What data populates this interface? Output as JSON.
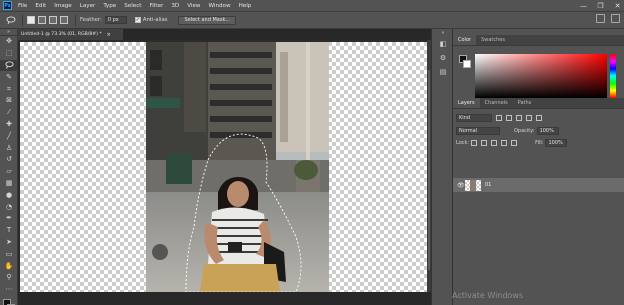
{
  "menubar": {
    "logo": "Ps",
    "items": [
      "File",
      "Edit",
      "Image",
      "Layer",
      "Type",
      "Select",
      "Filter",
      "3D",
      "View",
      "Window",
      "Help"
    ]
  },
  "window_controls": [
    "—",
    "❐",
    "✕"
  ],
  "options": {
    "feather_label": "Feather:",
    "feather_value": "0 px",
    "antialias_label": "Anti-alias",
    "antialias_checked": true,
    "select_mask_label": "Select and Mask..."
  },
  "document": {
    "tab_title": "Untitled-1 @ 73.3% (01, RGB/8#) *",
    "tab_close": "×"
  },
  "color_panel": {
    "tabs": [
      "Color",
      "Swatches"
    ],
    "foreground": "#111111",
    "background": "#ffffff"
  },
  "layers_panel": {
    "tabs": [
      "Layers",
      "Channels",
      "Paths"
    ],
    "kind_label": "Kind",
    "blend_mode": "Normal",
    "opacity_label": "Opacity:",
    "opacity_value": "100%",
    "lock_label": "Lock:",
    "fill_label": "Fill:",
    "fill_value": "100%",
    "layers": [
      {
        "name": "01",
        "visible": true
      }
    ]
  },
  "watermark": "Activate Windows"
}
